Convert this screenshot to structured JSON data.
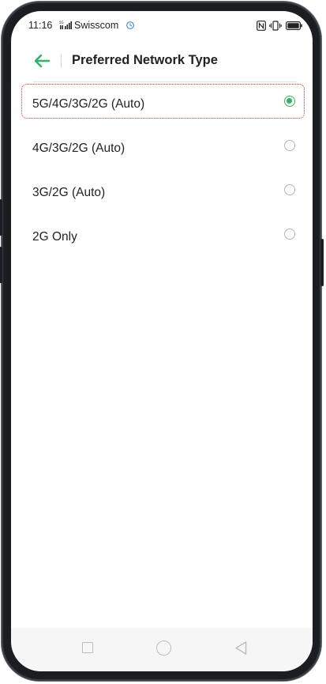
{
  "status_bar": {
    "time": "11:16",
    "carrier": "Swisscom",
    "icons": [
      "signal-icon",
      "sync-icon",
      "nfc-icon",
      "vibrate-icon",
      "battery-icon"
    ]
  },
  "header": {
    "back_icon": "arrow-left-icon",
    "title": "Preferred Network Type"
  },
  "options": [
    {
      "label": "5G/4G/3G/2G (Auto)",
      "selected": true
    },
    {
      "label": "4G/3G/2G (Auto)",
      "selected": false
    },
    {
      "label": "3G/2G (Auto)",
      "selected": false
    },
    {
      "label": "2G Only",
      "selected": false
    }
  ],
  "nav_bar": {
    "icons": [
      "recents-square-icon",
      "home-circle-icon",
      "back-triangle-icon"
    ]
  },
  "colors": {
    "accent": "#2db567",
    "highlight_border": "#e0312f",
    "text": "#222222"
  }
}
